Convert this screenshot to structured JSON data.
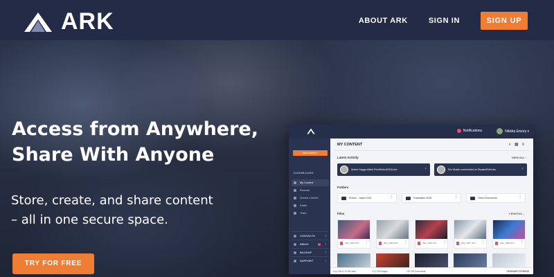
{
  "header": {
    "logo_text": "ARK",
    "nav": [
      "ABOUT ARK",
      "SIGN IN"
    ],
    "signup_label": "SIGN UP"
  },
  "hero": {
    "headline_line1": "Access from Anywhere,",
    "headline_line2": "Share With Anyone",
    "subcopy_line1": "Store, create, and share content",
    "subcopy_line2": "– all in one secure space.",
    "cta_label": "TRY FOR FREE"
  },
  "mockup": {
    "upload_label": "Add content  +",
    "notifications": "Notifications",
    "user_name": "Nikkita Emory",
    "sidebar_heading": "DASHBOARD",
    "sidebar_items": [
      "My Content",
      "Recents",
      "Shared Content",
      "Drafts",
      "Trash"
    ],
    "sidebar_sections": [
      "CONTACTS",
      "INBOX",
      "BACKUP",
      "SUPPORT"
    ],
    "main_title": "MY CONTENT",
    "latest_activity": "Latest Activity",
    "view_all": "VIEW ALL",
    "activity": [
      "Amber Naggs edited PriceRefund2018.doc",
      "Eric Mosler commented on DisasterBrief.doc"
    ],
    "folders_heading": "Folders",
    "folders": [
      "Photos - Japan 2018",
      "Graduation 2018",
      "Client Documents"
    ],
    "files_heading": "Files",
    "photos_filter": "PHOTOS",
    "files": [
      "IMG_1084.JPG",
      "IMG_1085.JPG",
      "IMG_1086.JPG",
      "IMG_1087.JPG",
      "IMG_1088.JPG"
    ],
    "footer_stats": [
      "5.14 GB of 10 GB used",
      "3.11 GB Images",
      "120 GB Documents"
    ],
    "upgrade": "UPGRADE STORAGE"
  },
  "colors": {
    "accent": "#f07d34",
    "header_bg": "#232b46",
    "sidebar_bg": "#2a3450"
  }
}
